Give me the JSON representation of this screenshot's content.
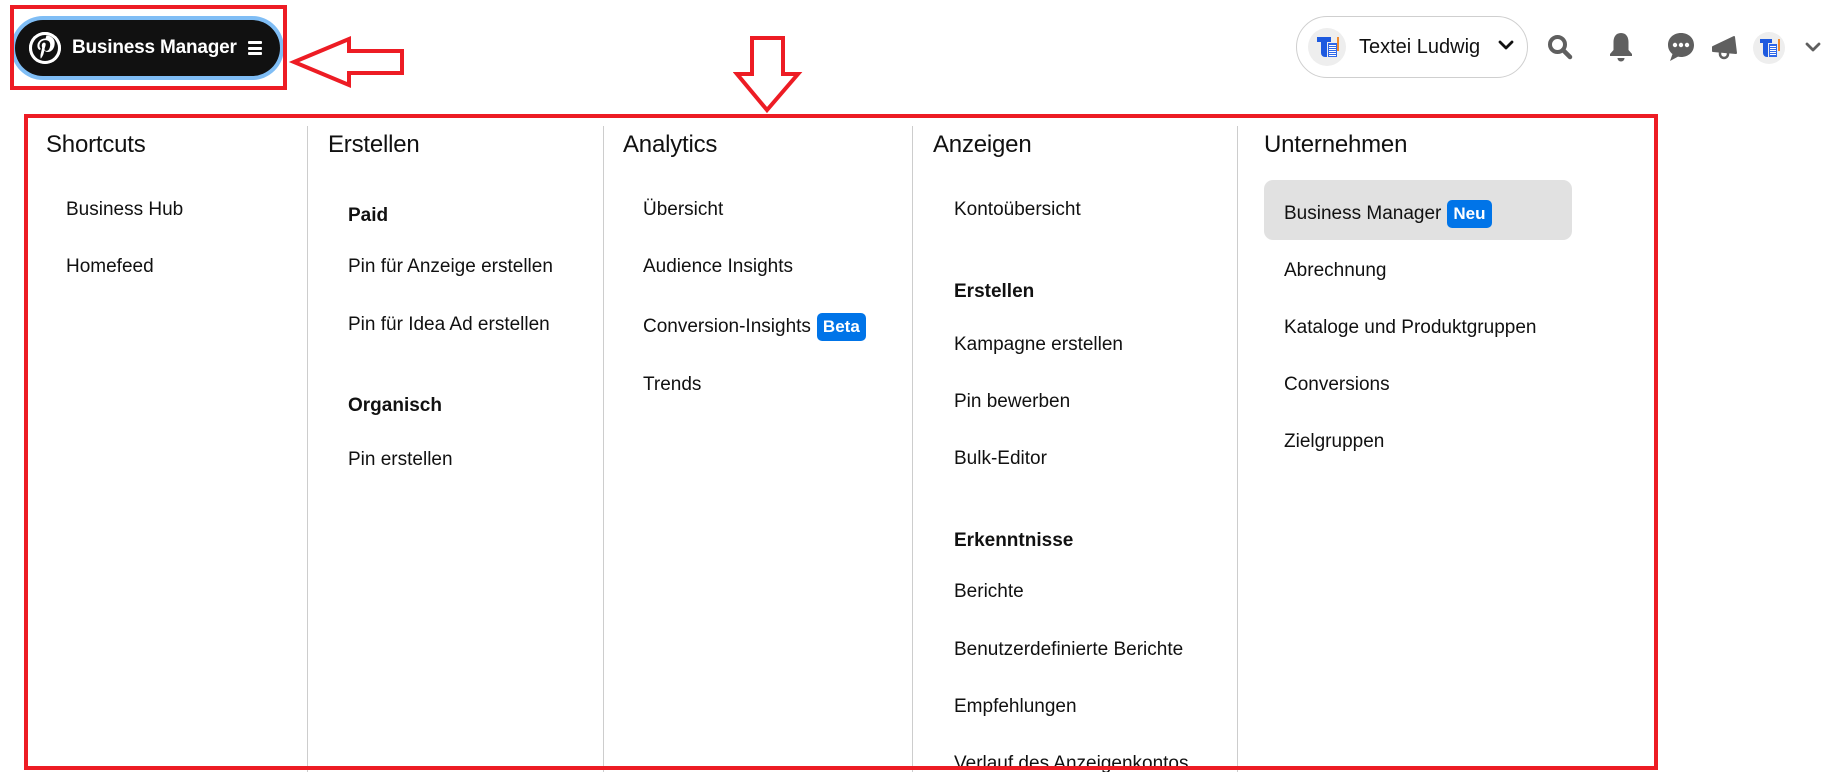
{
  "header": {
    "business_manager_label": "Business Manager",
    "account_name": "Textei Ludwig",
    "icons": [
      "pinterest-logo-icon",
      "menu-icon",
      "chevron-down-icon",
      "search-icon",
      "bell-icon",
      "chat-icon",
      "megaphone-icon",
      "avatar",
      "chevron-down-icon"
    ]
  },
  "menu": {
    "columns": [
      {
        "title": "Shortcuts",
        "items": [
          "Business Hub",
          "Homefeed"
        ]
      },
      {
        "title": "Erstellen",
        "groups": [
          {
            "heading": "Paid",
            "items": [
              "Pin für Anzeige erstellen",
              "Pin für Idea Ad erstellen"
            ]
          },
          {
            "heading": "Organisch",
            "items": [
              "Pin erstellen"
            ]
          }
        ]
      },
      {
        "title": "Analytics",
        "items": [
          "Übersicht",
          "Audience Insights",
          "Conversion-Insights",
          "Trends"
        ],
        "badge": "Beta"
      },
      {
        "title": "Anzeigen",
        "top_item": "Kontoübersicht",
        "groups": [
          {
            "heading": "Erstellen",
            "items": [
              "Kampagne erstellen",
              "Pin bewerben",
              "Bulk-Editor"
            ]
          },
          {
            "heading": "Erkenntnisse",
            "items": [
              "Berichte",
              "Benutzerdefinierte Berichte",
              "Empfehlungen",
              "Verlauf des Anzeigenkontos"
            ]
          }
        ]
      },
      {
        "title": "Unternehmen",
        "items": [
          "Business Manager",
          "Abrechnung",
          "Kataloge und Produktgruppen",
          "Conversions",
          "Zielgruppen"
        ],
        "badge": "Neu",
        "selected_item": "Business Manager"
      }
    ]
  },
  "colors": {
    "annotation_red": "#ed1c24",
    "badge_blue": "#0074e8",
    "pill_dark": "#111111",
    "pill_ring": "#7fbdf5",
    "highlight_bg": "#e1e1e1",
    "icon_gray": "#5f5f5f"
  }
}
